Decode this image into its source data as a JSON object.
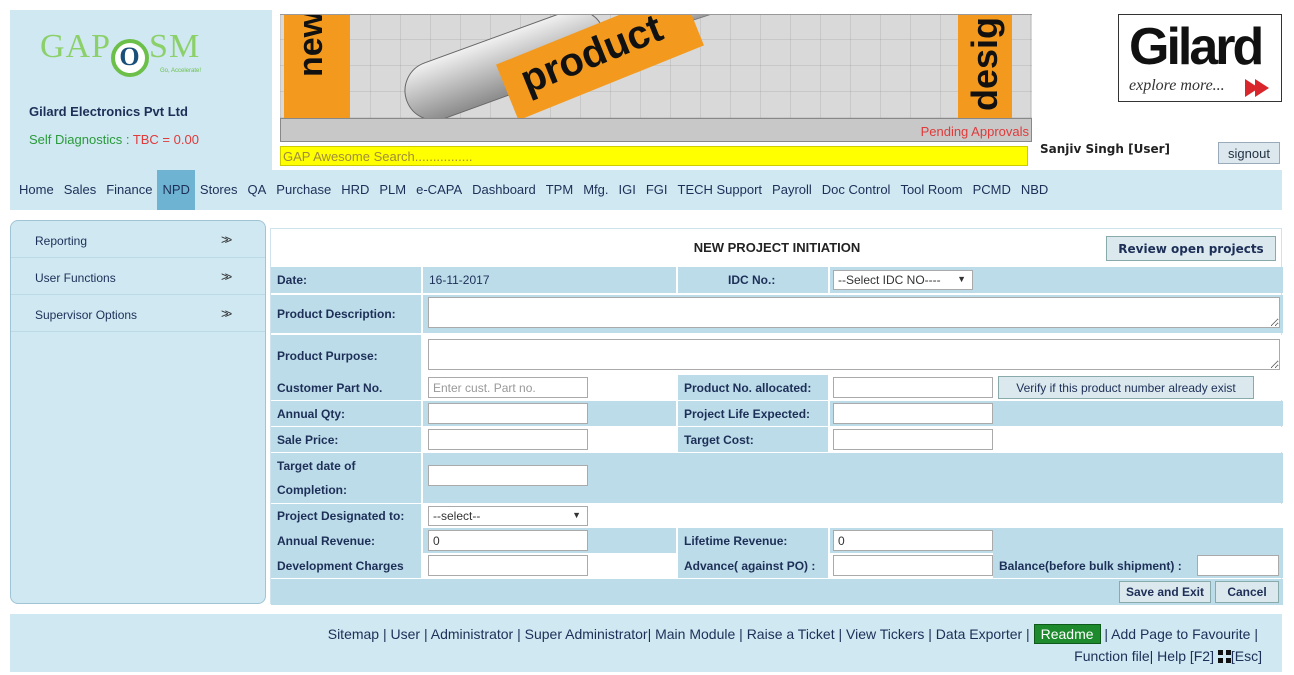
{
  "header": {
    "brand": {
      "g": "GAP",
      "o": "O",
      "sm": "SM",
      "tag": "Go, Accelerate!"
    },
    "company": "Gilard Electronics Pvt Ltd",
    "self_diag_label": "Self Diagnostics : ",
    "self_diag_value": "TBC = 0.00",
    "banner_words": {
      "new": "new",
      "product": "product",
      "design": "design"
    },
    "ticker": "Pending Approvals",
    "search_placeholder": "GAP Awesome Search................",
    "gilard_logo": "Gilard",
    "gilard_tagline": "explore more...",
    "user": "Sanjiv Singh [User]",
    "signout": "signout"
  },
  "nav": [
    "Home",
    "Sales",
    "Finance",
    "NPD",
    "Stores",
    "QA",
    "Purchase",
    "HRD",
    "PLM",
    "e-CAPA",
    "Dashboard",
    "TPM",
    "Mfg.",
    "IGI",
    "FGI",
    "TECH Support",
    "Payroll",
    "Doc Control",
    "Tool Room",
    "PCMD",
    "NBD"
  ],
  "nav_active": "NPD",
  "sidebar": [
    {
      "label": "Reporting",
      "arrow": ">>"
    },
    {
      "label": "User Functions",
      "arrow": ">>"
    },
    {
      "label": "Supervisor Options",
      "arrow": ">>"
    }
  ],
  "form": {
    "title": "NEW PROJECT INITIATION",
    "review_button": "Review open projects",
    "date_label": "Date:",
    "date_value": "16-11-2017",
    "idc_label": "IDC No.:",
    "idc_select": "--Select IDC NO----",
    "product_description": "Product Description:",
    "product_purpose": "Product Purpose:",
    "customer_part_no": "Customer Part No.",
    "customer_part_placeholder": "Enter cust. Part no.",
    "product_no_allocated": "Product No. allocated:",
    "verify_button": "Verify if this product number  already exist",
    "annual_qty": "Annual Qty:",
    "project_life_expected": "Project Life Expected:",
    "sale_price": "Sale Price:",
    "target_cost": "Target Cost:",
    "target_date_line1": "Target date of",
    "target_date_line2": "Completion:",
    "project_designated_to": "Project Designated to:",
    "designated_select": "--select--",
    "annual_revenue": "Annual Revenue:",
    "annual_revenue_value": "0",
    "lifetime_revenue": "Lifetime Revenue:",
    "lifetime_revenue_value": "0",
    "development_charges": "Development Charges",
    "advance_against_po": "Advance( against PO) :",
    "balance": "Balance(before bulk shipment) :",
    "save_exit": "Save and Exit",
    "cancel": "Cancel"
  },
  "footer": {
    "line1": [
      "Sitemap",
      " | ",
      "User",
      " | ",
      "Administrator",
      " | ",
      "Super Administrator",
      "| ",
      "Main Module",
      " | ",
      "Raise a Ticket",
      " | ",
      "View Tickers",
      " | ",
      "Data Exporter",
      " | "
    ],
    "readme": "Readme",
    "line1_after": " | Add Page to Favourite |",
    "line2_a": "Function file",
    "line2_b": "| Help [F2] ",
    "line2_c": "[Esc]"
  }
}
